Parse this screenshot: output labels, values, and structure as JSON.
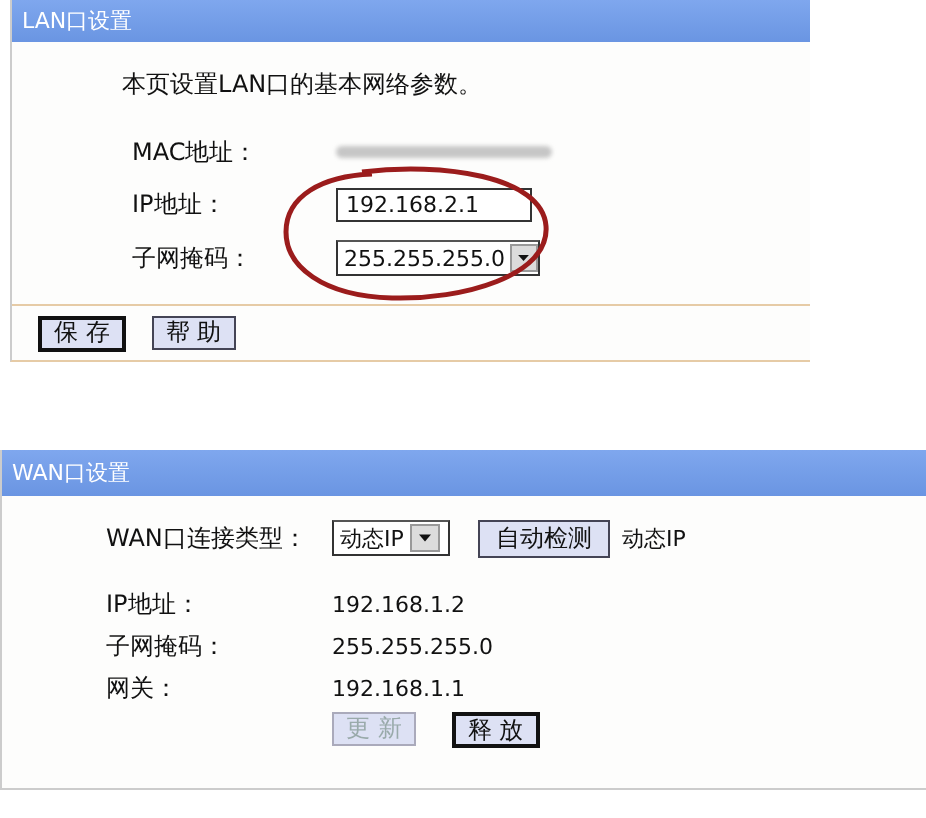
{
  "lan": {
    "title": "LAN口设置",
    "description": "本页设置LAN口的基本网络参数。",
    "fields": [
      {
        "kind": "static",
        "label": "MAC地址：",
        "redacted": true,
        "circled": false
      },
      {
        "kind": "input",
        "label": "IP地址：",
        "value": "192.168.2.1",
        "circled": true
      },
      {
        "kind": "select",
        "label": "子网掩码：",
        "value": "255.255.255.0",
        "circled": true
      }
    ],
    "buttons": [
      {
        "label": "保 存",
        "focused": true,
        "disabled": false
      },
      {
        "label": "帮 助",
        "focused": false,
        "disabled": false
      }
    ]
  },
  "wan": {
    "title": "WAN口设置",
    "connection": {
      "label": "WAN口连接类型：",
      "value": "动态IP",
      "detect_button": "自动检测",
      "detected": "动态IP"
    },
    "fields": [
      {
        "kind": "static",
        "label": "IP地址：",
        "value": "192.168.1.2"
      },
      {
        "kind": "static",
        "label": "子网掩码：",
        "value": "255.255.255.0"
      },
      {
        "kind": "static",
        "label": "网关：",
        "value": "192.168.1.1"
      }
    ],
    "buttons": [
      {
        "label": "更 新",
        "focused": false,
        "disabled": true
      },
      {
        "label": "释 放",
        "focused": true,
        "disabled": false
      }
    ]
  }
}
